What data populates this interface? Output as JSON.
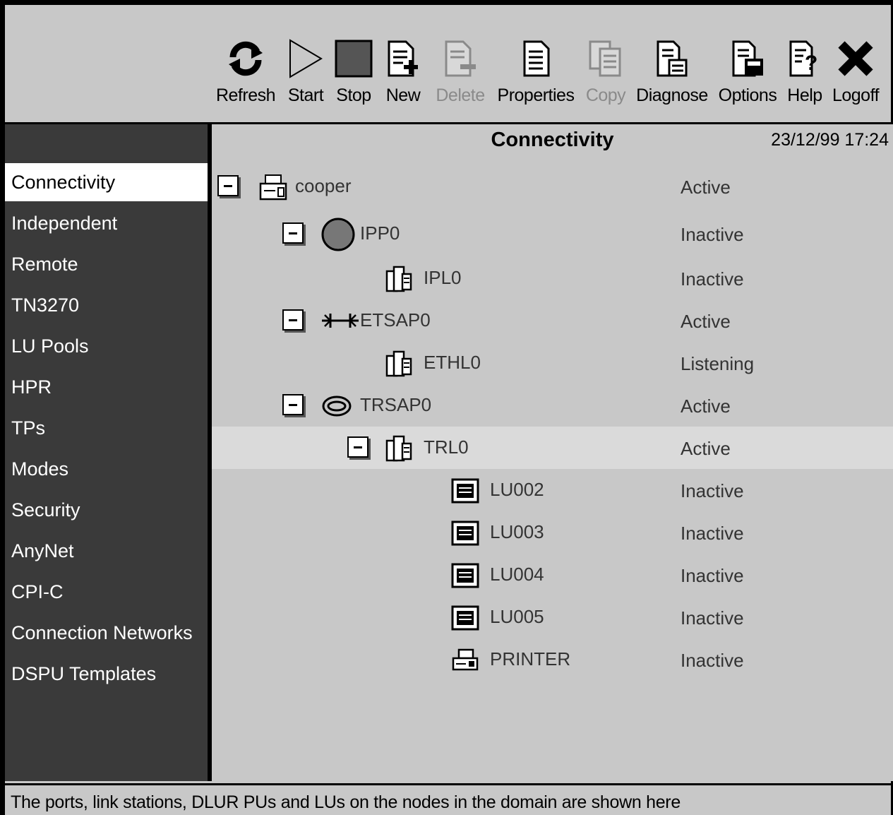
{
  "toolbar": {
    "refresh": "Refresh",
    "start": "Start",
    "stop": "Stop",
    "new": "New",
    "delete": "Delete",
    "properties": "Properties",
    "copy": "Copy",
    "diagnose": "Diagnose",
    "options": "Options",
    "help": "Help",
    "logoff": "Logoff"
  },
  "sidebar": {
    "items": [
      {
        "label": "Connectivity",
        "selected": true
      },
      {
        "label": "Independent"
      },
      {
        "label": "Remote"
      },
      {
        "label": "TN3270"
      },
      {
        "label": "LU Pools"
      },
      {
        "label": "HPR"
      },
      {
        "label": "TPs"
      },
      {
        "label": "Modes"
      },
      {
        "label": "Security"
      },
      {
        "label": "AnyNet"
      },
      {
        "label": "CPI-C"
      },
      {
        "label": "Connection Networks"
      },
      {
        "label": "DSPU Templates"
      }
    ]
  },
  "main": {
    "title": "Connectivity",
    "timestamp": "23/12/99 17:24",
    "tree": [
      {
        "name": "cooper",
        "status": "Active",
        "icon": "node-icon",
        "expanded": true
      },
      {
        "name": "IPP0",
        "status": "Inactive",
        "icon": "port-icon",
        "expanded": true
      },
      {
        "name": "IPL0",
        "status": "Inactive",
        "icon": "link-station-icon"
      },
      {
        "name": "ETSAP0",
        "status": "Active",
        "icon": "ethernet-port-icon",
        "expanded": true
      },
      {
        "name": "ETHL0",
        "status": "Listening",
        "icon": "link-station-icon"
      },
      {
        "name": "TRSAP0",
        "status": "Active",
        "icon": "token-ring-port-icon",
        "expanded": true
      },
      {
        "name": "TRL0",
        "status": "Active",
        "icon": "link-station-icon",
        "expanded": true,
        "selected": true
      },
      {
        "name": "LU002",
        "status": "Inactive",
        "icon": "lu-icon"
      },
      {
        "name": "LU003",
        "status": "Inactive",
        "icon": "lu-icon"
      },
      {
        "name": "LU004",
        "status": "Inactive",
        "icon": "lu-icon"
      },
      {
        "name": "LU005",
        "status": "Inactive",
        "icon": "lu-icon"
      },
      {
        "name": "PRINTER",
        "status": "Inactive",
        "icon": "printer-icon"
      }
    ]
  },
  "statusbar": {
    "text": "The ports, link stations, DLUR PUs and LUs on the nodes in the domain are shown here"
  }
}
